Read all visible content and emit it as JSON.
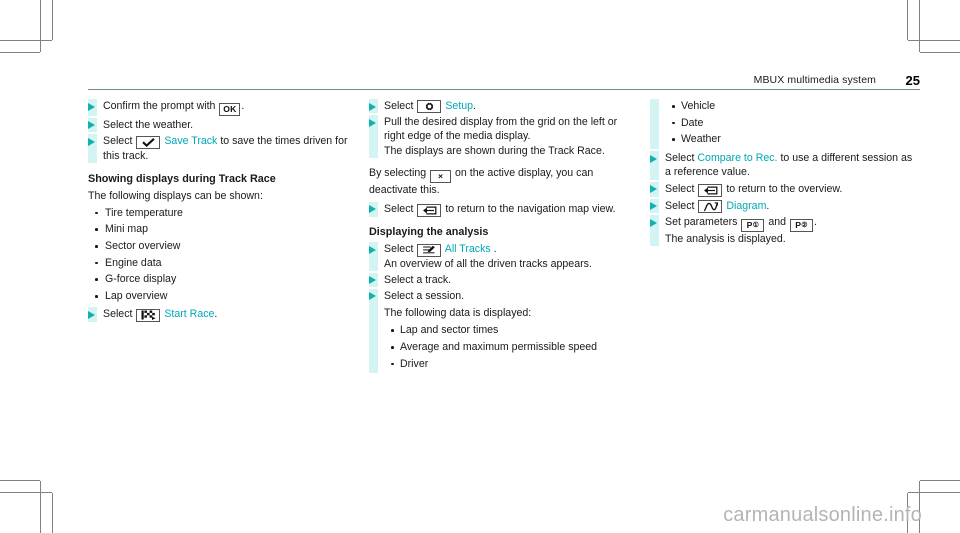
{
  "header": {
    "title": "MBUX multimedia system",
    "page_number": "25"
  },
  "watermark": "carmanualsonline.info",
  "colors": {
    "accent_link": "#00a7b5",
    "arrow_teal": "#0fb2ad",
    "bar_bg": "#d4f3f3",
    "rule": "#6f8f8f"
  },
  "columns": {
    "left": {
      "steps": [
        {
          "id": "confirm-prompt",
          "text_before": "Confirm the prompt with",
          "key_label": "OK",
          "text_after": "."
        },
        {
          "id": "select-weather",
          "text": "Select the weather."
        },
        {
          "id": "select-save-track",
          "text_before": "Select",
          "icon": "checkmark-icon",
          "link_label": "Save Track",
          "text_after": "to save the times driven for this track."
        }
      ],
      "subheading": "Showing displays during Track Race",
      "intro": "The following displays can be shown:",
      "display_items": [
        "Tire temperature",
        "Mini map",
        "Sector overview",
        "Engine data",
        "G-force display",
        "Lap overview"
      ],
      "start_step": {
        "id": "select-start-race",
        "text_before": "Select",
        "icon": "checkered-flag-icon",
        "link_label": "Start Race",
        "text_after": "."
      }
    },
    "middle": {
      "steps": [
        {
          "id": "select-setup",
          "text_before": "Select",
          "icon": "gear-icon",
          "link_label": "Setup",
          "text_after": "."
        },
        {
          "id": "pull-display",
          "text": "Pull the desired display from the grid on the left or right edge of the media display.",
          "text2": "The displays are shown during the Track Race."
        }
      ],
      "deactivate": {
        "text_before": "By selecting",
        "key_label": "×",
        "text_after": "on the active display, you can deactivate this."
      },
      "return_step": {
        "id": "select-return-nav",
        "text_before": "Select",
        "icon": "back-arrow-icon",
        "text_after": "to return to the navigation map view."
      },
      "subheading": "Displaying the analysis",
      "steps2": [
        {
          "id": "select-all-tracks",
          "text_before": "Select",
          "icon": "tracks-list-icon",
          "link_label": "All Tracks",
          "text_after": ".",
          "note": "An overview of all the driven tracks appears."
        },
        {
          "id": "select-a-track",
          "text": "Select a track."
        },
        {
          "id": "select-a-session",
          "text": "Select a session.",
          "note": "The following data is displayed:",
          "items": [
            "Lap and sector times",
            "Average and maximum permissible speed",
            "Driver"
          ]
        }
      ]
    },
    "right": {
      "lead_items": [
        "Vehicle",
        "Date",
        "Weather"
      ],
      "steps": [
        {
          "id": "select-compare-to-rec",
          "text_before": "Select",
          "link_label": "Compare to Rec.",
          "text_after": "to use a different session as a reference value."
        },
        {
          "id": "select-return-overview",
          "text_before": "Select",
          "icon": "back-arrow-icon",
          "text_after": "to return to the overview."
        },
        {
          "id": "select-diagram",
          "text_before": "Select",
          "icon": "diagram-icon",
          "link_label": "Diagram",
          "text_after": "."
        },
        {
          "id": "set-parameters",
          "text_before": "Set parameters",
          "key_label_1": "P",
          "key_sub_1": "①",
          "text_mid": "and",
          "key_label_2": "P",
          "key_sub_2": "②",
          "text_after": ".",
          "note": "The analysis is displayed."
        }
      ]
    }
  }
}
